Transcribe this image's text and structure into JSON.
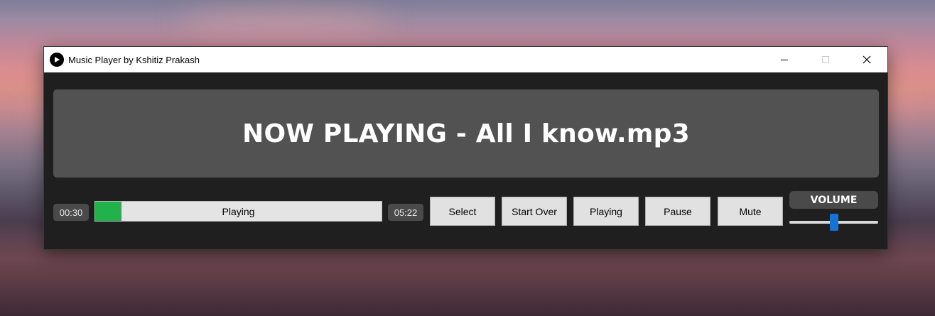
{
  "window": {
    "title": "Music Player by Kshitiz Prakash",
    "icon": "play-circle-icon",
    "controls": [
      "minimize-icon",
      "maximize-icon",
      "close-icon"
    ]
  },
  "banner": {
    "text": "NOW PLAYING - All I know.mp3"
  },
  "playback": {
    "elapsed": "00:30",
    "total": "05:22",
    "status_label": "Playing",
    "progress_fraction": 0.093,
    "progress_color": "#22b24c"
  },
  "buttons": {
    "select": "Select",
    "start_over": "Start Over",
    "playing": "Playing",
    "pause": "Pause",
    "mute": "Mute"
  },
  "volume": {
    "label": "VOLUME",
    "level_fraction": 0.5,
    "accent_color": "#1473d6"
  }
}
